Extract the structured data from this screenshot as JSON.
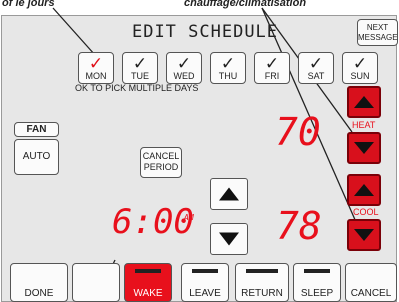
{
  "callouts": {
    "left": "of le jours",
    "right": "chauffage/climatisation"
  },
  "header": {
    "title": "EDIT SCHEDULE",
    "next_message": "NEXT MESSAGE"
  },
  "days": [
    {
      "label": "MON",
      "checked": true
    },
    {
      "label": "TUE",
      "checked": true
    },
    {
      "label": "WED",
      "checked": true
    },
    {
      "label": "THU",
      "checked": true
    },
    {
      "label": "FRI",
      "checked": true
    },
    {
      "label": "SAT",
      "checked": true
    },
    {
      "label": "SUN",
      "checked": true
    }
  ],
  "check_glyph": "✓",
  "multi_days_note": "OK TO PICK MULTIPLE DAYS",
  "fan": {
    "label": "FAN",
    "value": "AUTO"
  },
  "cancel_period": "CANCEL PERIOD",
  "time": {
    "value": "6:00",
    "suffix": "AM"
  },
  "heat": {
    "label": "HEAT",
    "setpoint": "70"
  },
  "cool": {
    "label": "COOL",
    "setpoint": "78"
  },
  "bottom_buttons": {
    "done": "DONE",
    "wake": "WAKE",
    "leave": "LEAVE",
    "return": "RETURN",
    "sleep": "SLEEP",
    "cancel": "CANCEL"
  },
  "colors": {
    "accent_red": "#e8101c",
    "screen_bg": "#e7e7e7"
  }
}
